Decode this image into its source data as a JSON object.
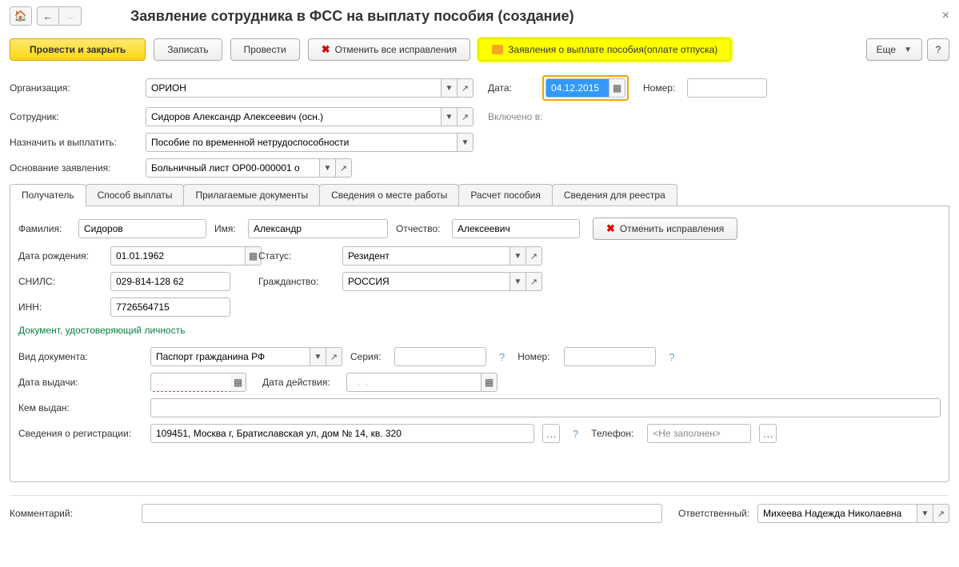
{
  "header": {
    "title": "Заявление сотрудника в ФСС на выплату пособия (создание)"
  },
  "toolbar": {
    "submit_close": "Провести и закрыть",
    "save": "Записать",
    "submit": "Провести",
    "cancel_all": "Отменить все исправления",
    "applications": "Заявления о выплате пособия(оплате отпуска)",
    "more": "Еще",
    "help": "?"
  },
  "labels": {
    "org": "Организация:",
    "date": "Дата:",
    "number": "Номер:",
    "employee": "Сотрудник:",
    "included": "Включено в:",
    "assign": "Назначить и выплатить:",
    "basis": "Основание заявления:"
  },
  "fields": {
    "org": "ОРИОН",
    "date": "04.12.2015",
    "number": "",
    "employee": "Сидоров Александр Алексеевич (осн.)",
    "assign": "Пособие по временной нетрудоспособности",
    "basis": "Больничный лист ОР00-000001 о"
  },
  "tabs": [
    "Получатель",
    "Способ выплаты",
    "Прилагаемые документы",
    "Сведения о месте работы",
    "Расчет пособия",
    "Сведения для реестра"
  ],
  "recipient": {
    "labels": {
      "lastname": "Фамилия:",
      "firstname": "Имя:",
      "patronymic": "Отчество:",
      "cancel": "Отменить исправления",
      "birthdate": "Дата рождения:",
      "status": "Статус:",
      "snils": "СНИЛС:",
      "citizenship": "Гражданство:",
      "inn": "ИНН:",
      "doc_section": "Документ, удостоверяющий личность",
      "doctype": "Вид документа:",
      "series": "Серия:",
      "docnumber": "Номер:",
      "issue_date": "Дата выдачи:",
      "valid_date": "Дата действия:",
      "issued_by": "Кем выдан:",
      "registration": "Сведения о регистрации:",
      "phone": "Телефон:"
    },
    "values": {
      "lastname": "Сидоров",
      "firstname": "Александр",
      "patronymic": "Алексеевич",
      "birthdate": "01.01.1962",
      "status": "Резидент",
      "snils": "029-814-128 62",
      "citizenship": "РОССИЯ",
      "inn": "7726564715",
      "doctype": "Паспорт гражданина РФ",
      "series": "",
      "docnumber": "",
      "issue_date": "  .  .    ",
      "valid_date": "  .  .    ",
      "issued_by": "",
      "registration": "109451, Москва г, Братиславская ул, дом № 14, кв. 320",
      "phone": "<Не заполнен>"
    }
  },
  "footer": {
    "comment_label": "Комментарий:",
    "comment": "",
    "responsible_label": "Ответственный:",
    "responsible": "Михеева Надежда Николаевна"
  }
}
